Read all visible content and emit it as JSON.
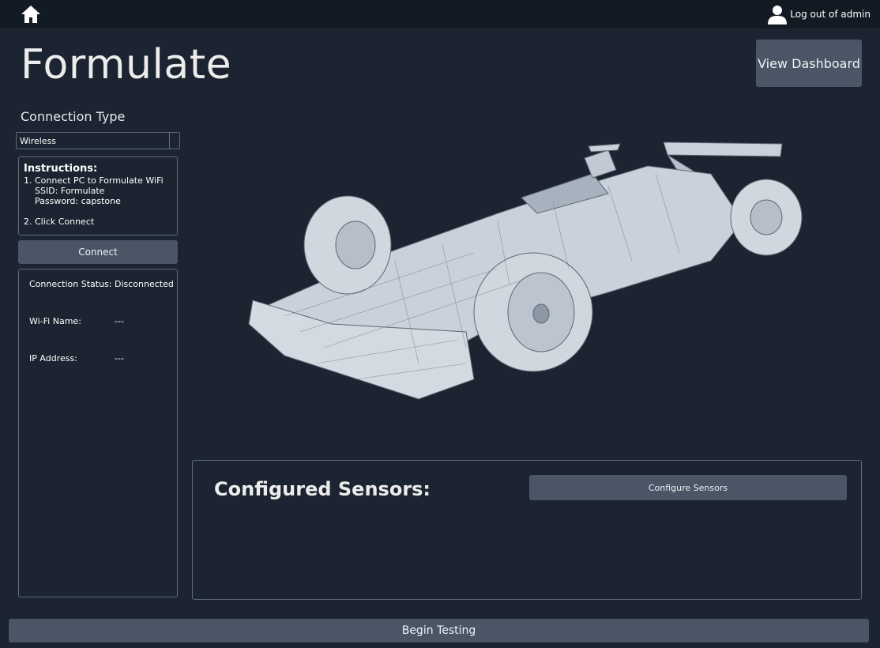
{
  "header": {
    "home_icon": "home-icon",
    "user_icon": "user-icon",
    "logout_label": "Log out of admin"
  },
  "app_title": "Formulate",
  "view_dashboard_label": "View Dashboard",
  "connection": {
    "label": "Connection Type",
    "selected": "Wireless"
  },
  "instructions": {
    "heading": "Instructions:",
    "line1": "1. Connect PC to Formulate WiFi",
    "line2": "SSID: Formulate",
    "line3": "Password: capstone",
    "line4": "2. Click Connect"
  },
  "connect_label": "Connect",
  "status": {
    "connection_status_key": "Connection Status:",
    "connection_status_value": "Disconnected",
    "wifi_key": "Wi-Fi Name:",
    "wifi_value": "---",
    "ip_key": "IP Address:",
    "ip_value": "---"
  },
  "sensors": {
    "title": "Configured Sensors:",
    "configure_label": "Configure Sensors"
  },
  "begin_label": "Begin Testing",
  "colors": {
    "background": "#1b2430",
    "topbar": "#121a23",
    "button": "#4a5566",
    "border": "#5f6b7b"
  }
}
